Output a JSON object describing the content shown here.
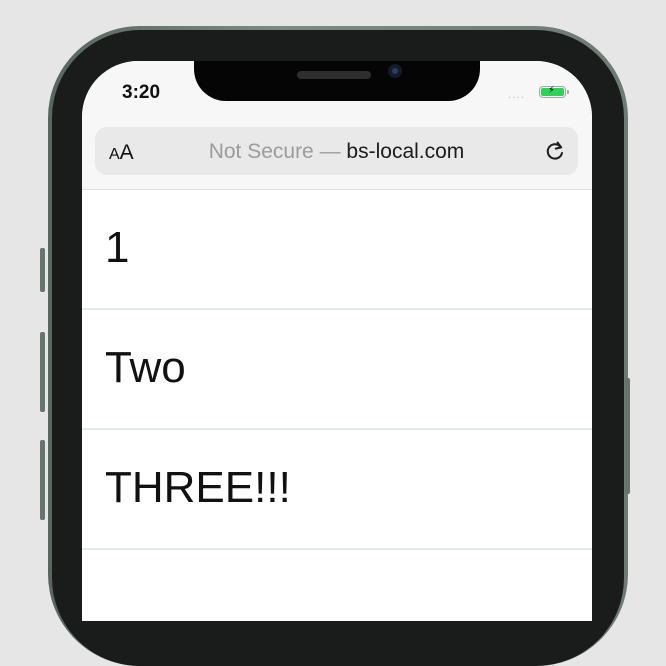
{
  "status_bar": {
    "time": "3:20",
    "signal": "....",
    "battery_color": "#30d158"
  },
  "browser": {
    "text_size_small": "A",
    "text_size_large": "A",
    "url_prefix": "Not Secure — ",
    "url_domain": "bs-local.com",
    "reload_icon": "reload-icon"
  },
  "list": {
    "items": [
      {
        "label": "1"
      },
      {
        "label": "Two"
      },
      {
        "label": "THREE!!!"
      },
      {
        "label": ""
      }
    ]
  },
  "colors": {
    "frame": "#6c7b74",
    "divider": "#e4e9ed",
    "background": "#e6e6e6"
  }
}
